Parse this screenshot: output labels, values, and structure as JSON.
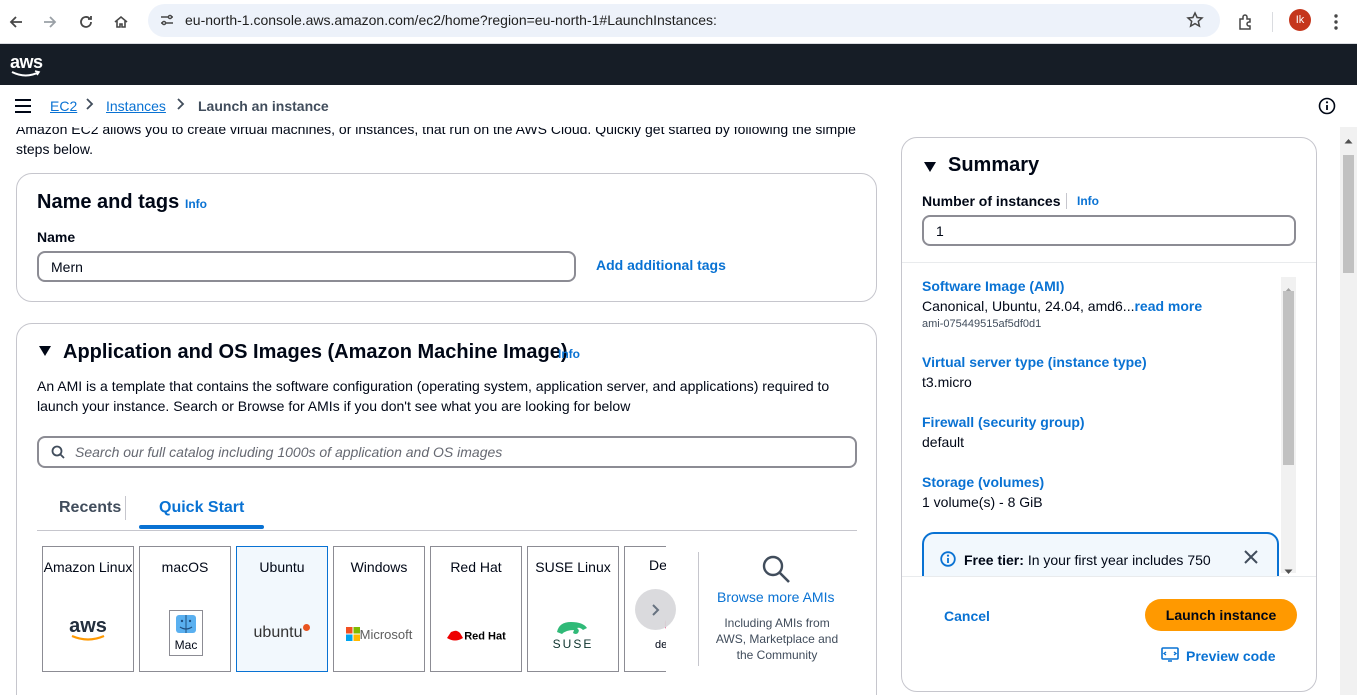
{
  "browser": {
    "url": "eu-north-1.console.aws.amazon.com/ec2/home?region=eu-north-1#LaunchInstances:",
    "avatar_initials": "Ik"
  },
  "aws_header": {
    "logo": "aws"
  },
  "breadcrumb": {
    "items": [
      "EC2",
      "Instances",
      "Launch an instance"
    ]
  },
  "intro_text": "Amazon EC2 allows you to create virtual machines, or instances, that run on the AWS Cloud. Quickly get started by following the simple steps below.",
  "name_tags": {
    "title": "Name and tags",
    "info": "Info",
    "name_label": "Name",
    "name_value": "Mern",
    "add_tags": "Add additional tags"
  },
  "ami": {
    "title": "Application and OS Images (Amazon Machine Image)",
    "info": "Info",
    "description": "An AMI is a template that contains the software configuration (operating system, application server, and applications) required to launch your instance. Search or Browse for AMIs if you don't see what you are looking for below",
    "search_placeholder": "Search our full catalog including 1000s of application and OS images",
    "tabs": [
      "Recents",
      "Quick Start"
    ],
    "tiles": [
      {
        "label": "Amazon Linux",
        "logo": "aws"
      },
      {
        "label": "macOS",
        "logo": "Mac"
      },
      {
        "label": "Ubuntu",
        "logo": "ubuntu"
      },
      {
        "label": "Windows",
        "logo": "Microsoft"
      },
      {
        "label": "Red Hat",
        "logo": "Red Hat"
      },
      {
        "label": "SUSE Linux",
        "logo": "SUSE"
      },
      {
        "label": "De",
        "logo": "de"
      }
    ],
    "browse_more": "Browse more AMIs",
    "browse_sub": "Including AMIs from AWS, Marketplace and the Community"
  },
  "summary": {
    "title": "Summary",
    "num_label": "Number of instances",
    "num_info": "Info",
    "num_value": "1",
    "items": [
      {
        "key": "Software Image (AMI)",
        "value": "Canonical, Ubuntu, 24.04, amd6...",
        "link": "read more",
        "sub": "ami-075449515af5df0d1"
      },
      {
        "key": "Virtual server type (instance type)",
        "value": "t3.micro"
      },
      {
        "key": "Firewall (security group)",
        "value": "default"
      },
      {
        "key": "Storage (volumes)",
        "value": "1 volume(s) - 8 GiB"
      }
    ],
    "free_tier_label": "Free tier:",
    "free_tier_text": "In your first year includes 750",
    "cancel": "Cancel",
    "launch": "Launch instance",
    "preview": "Preview code"
  },
  "colors": {
    "link": "#0972d3",
    "primary_button": "#ff9900",
    "header_bg": "#161d26"
  }
}
